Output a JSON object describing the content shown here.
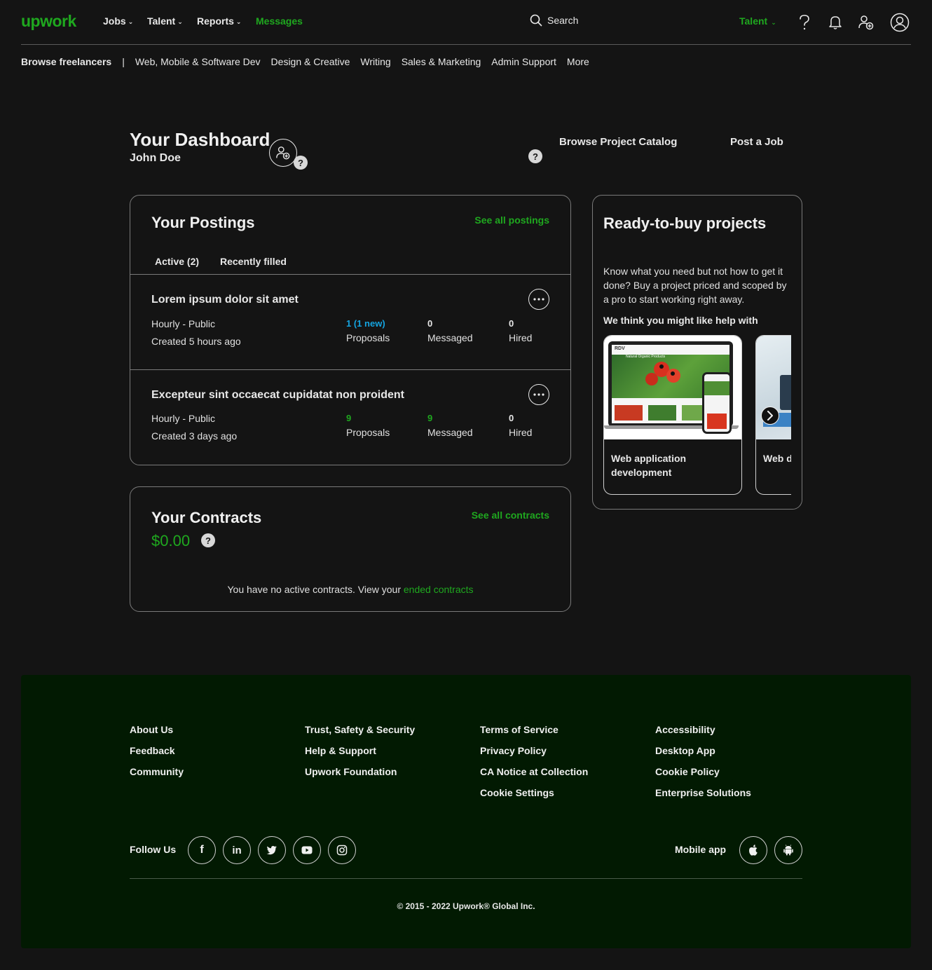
{
  "brand": {
    "logo_text": "upwork",
    "accent_color": "#1fa81f",
    "link_color": "#14a4e0"
  },
  "topnav": {
    "items": [
      {
        "label": "Jobs",
        "has_dropdown": true
      },
      {
        "label": "Talent",
        "has_dropdown": true
      },
      {
        "label": "Reports",
        "has_dropdown": true
      },
      {
        "label": "Messages",
        "has_dropdown": false
      }
    ],
    "search_label": "Search",
    "talent_switch": "Talent",
    "icons": [
      "help-icon",
      "bell-icon",
      "add-user-icon",
      "account-icon"
    ]
  },
  "categories": {
    "browse": "Browse freelancers",
    "separator": "|",
    "items": [
      "Web, Mobile & Software Dev",
      "Design & Creative",
      "Writing",
      "Sales & Marketing",
      "Admin Support",
      "More"
    ]
  },
  "dashboard": {
    "title": "Your Dashboard",
    "user": "John Doe",
    "help_glyph": "?",
    "browse_catalog": "Browse Project Catalog",
    "post_job": "Post a Job"
  },
  "postings": {
    "title": "Your Postings",
    "see_all": "See all postings",
    "tabs": [
      "Active (2)",
      "Recently filled"
    ],
    "items": [
      {
        "title": "Lorem ipsum dolor sit amet",
        "type": "Hourly - Public",
        "created": "Created 5 hours ago",
        "proposals_value": "1",
        "proposals_new": "(1 new)",
        "proposals_label": "Proposals",
        "messaged_value": "0",
        "messaged_label": "Messaged",
        "hired_value": "0",
        "hired_label": "Hired"
      },
      {
        "title": "Excepteur sint occaecat cupidatat non proident",
        "type": "Hourly - Public",
        "created": "Created 3 days ago",
        "proposals_value": "9",
        "proposals_new": "",
        "proposals_label": "Proposals",
        "messaged_value": "9",
        "messaged_label": "Messaged",
        "hired_value": "0",
        "hired_label": "Hired"
      }
    ]
  },
  "contracts": {
    "title": "Your Contracts",
    "see_all": "See all contracts",
    "amount": "$0.00",
    "empty_text": "You have no active contracts. View your",
    "ended_link": "ended contracts"
  },
  "ready": {
    "title": "Ready-to-buy projects",
    "description": "Know what you need but not how to get it done? Buy a project priced and scoped by a pro to start working right away.",
    "subheading": "We think you might like help with",
    "projects": [
      {
        "label": "Web application development",
        "screen_logo": "RDV",
        "screen_caption": "Natural Organic Products"
      },
      {
        "label": "Web d"
      }
    ]
  },
  "footer": {
    "columns": [
      [
        "About Us",
        "Feedback",
        "Community"
      ],
      [
        "Trust, Safety & Security",
        "Help & Support",
        "Upwork Foundation"
      ],
      [
        "Terms of Service",
        "Privacy Policy",
        "CA Notice at Collection",
        "Cookie Settings"
      ],
      [
        "Accessibility",
        "Desktop App",
        "Cookie Policy",
        "Enterprise Solutions"
      ]
    ],
    "follow_us": "Follow Us",
    "social": [
      {
        "name": "facebook-icon",
        "glyph": "f"
      },
      {
        "name": "linkedin-icon",
        "glyph": "in"
      },
      {
        "name": "twitter-icon",
        "glyph": ""
      },
      {
        "name": "youtube-icon",
        "glyph": ""
      },
      {
        "name": "instagram-icon",
        "glyph": ""
      }
    ],
    "mobile_app": "Mobile app",
    "apps": [
      "apple-icon",
      "android-icon"
    ],
    "copyright": "© 2015 - 2022 Upwork® Global Inc."
  }
}
